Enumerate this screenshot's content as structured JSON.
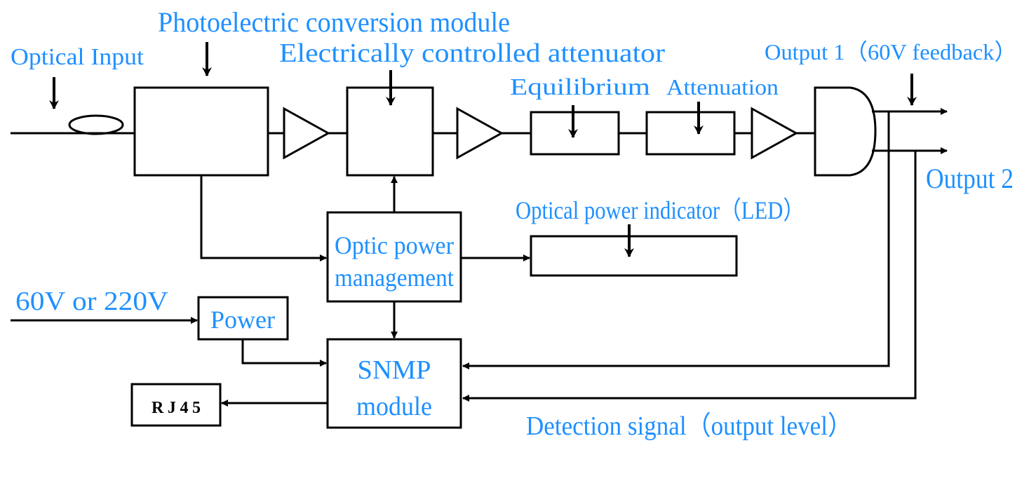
{
  "colors": {
    "label": "#1e90ff",
    "line": "#000000"
  },
  "labels": {
    "optical_input": "Optical Input",
    "photoelectric": "Photoelectric conversion module",
    "attenuator": "Electrically controlled attenuator",
    "equilibrium": "Equilibrium",
    "attenuation": "Attenuation",
    "output1": "Output 1（60V feedback）",
    "output2": "Output 2",
    "led": "Optical power indicator（LED）",
    "optic_power_1": "Optic power",
    "optic_power_2": "management",
    "supply": "60V or 220V",
    "power": "Power",
    "snmp_1": "SNMP",
    "snmp_2": "module",
    "rj45": "RJ45",
    "detection": "Detection signal（output level）"
  }
}
